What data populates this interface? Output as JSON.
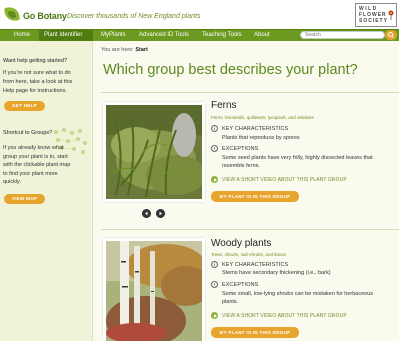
{
  "header": {
    "logo_text": "Go Botany",
    "tagline": "Discover thousands of New England plants",
    "partner_line1": "WILD",
    "partner_line2": "FLOWER",
    "partner_line3": "SOCIETY"
  },
  "nav": {
    "items": [
      "Home",
      "Plant Identifier",
      "MyPlants",
      "Advanced ID Tools",
      "Teaching Tools",
      "About"
    ],
    "search_placeholder": "Search"
  },
  "sidebar": {
    "help_heading": "Want help getting started?",
    "help_lines": [
      "If you're not sure what to do",
      "from here, take a look at this",
      "Help page for instructions."
    ],
    "help_button": "GET HELP",
    "shortcut_heading": "Shortcut to Groups?",
    "shortcut_lines": [
      "If you already know what",
      "group your plant is in, start",
      "with the clickable plant map",
      "to find your plant more",
      "quickly."
    ],
    "shortcut_button": "VIEW MAP"
  },
  "main": {
    "breadcrumb_prefix": "You are here:",
    "breadcrumb_current": "Start",
    "title": "Which group best describes your plant?",
    "groups": [
      {
        "name": "Ferns",
        "subtitle": "Ferns, horsetails, quillworts, lycopods, and relatives",
        "key_label": "KEY CHARACTERISTICS",
        "key_text": "Plants that reproduce by spores",
        "exceptions_label": "EXCEPTIONS",
        "exceptions_lines": [
          "Some seed plants have very frilly, highly dissected leaves that",
          "resemble ferns."
        ],
        "video_link": "VIEW A SHORT VIDEO ABOUT THIS PLANT GROUP",
        "button": "MY PLANT IS IN THIS GROUP"
      },
      {
        "name": "Woody plants",
        "subtitle": "Trees, shrubs, sub-shrubs, and lianas",
        "key_label": "KEY CHARACTERISTICS",
        "key_text": "Stems have secondary thickening (i.e., bark)",
        "exceptions_label": "EXCEPTIONS",
        "exceptions_lines": [
          "Some small, low-lying shrubs can be mistaken for herbaceous",
          "plants."
        ],
        "video_link": "VIEW A SHORT VIDEO ABOUT THIS PLANT GROUP",
        "button": "MY PLANT IS IN THIS GROUP"
      }
    ]
  },
  "icons": {
    "exceptions_icon_glyph": "!",
    "key_icon_glyph": "i"
  },
  "colors": {
    "brand_green": "#6a9a1f",
    "accent_orange": "#e8a52e",
    "title_green": "#5a8a1e"
  }
}
